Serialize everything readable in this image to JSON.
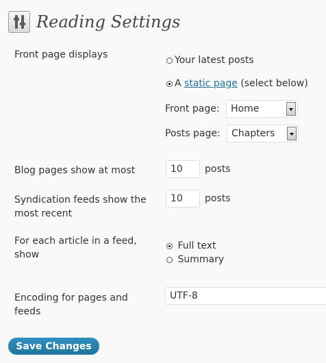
{
  "header": {
    "title": "Reading Settings",
    "icon": "settings-sliders-icon"
  },
  "front_page": {
    "label": "Front page displays",
    "options": [
      {
        "label": "Your latest posts",
        "checked": false
      },
      {
        "prefix": "A",
        "link_text": "static page",
        "suffix": "(select below)",
        "checked": true
      }
    ],
    "front_page_select": {
      "label": "Front page:",
      "value": "Home"
    },
    "posts_page_select": {
      "label": "Posts page:",
      "value": "Chapters"
    }
  },
  "blog_pages": {
    "label": "Blog pages show at most",
    "value": "10",
    "unit": "posts"
  },
  "syndication": {
    "label": "Syndication feeds show the most recent",
    "value": "10",
    "unit": "posts"
  },
  "feed_article": {
    "label": "For each article in a feed, show",
    "options": [
      {
        "label": "Full text",
        "checked": true
      },
      {
        "label": "Summary",
        "checked": false
      }
    ]
  },
  "encoding": {
    "label": "Encoding for pages and feeds",
    "value": "UTF-8"
  },
  "actions": {
    "save_label": "Save Changes"
  },
  "colors": {
    "link": "#21759b",
    "button": "#21759b",
    "background": "#f9f9f9"
  }
}
